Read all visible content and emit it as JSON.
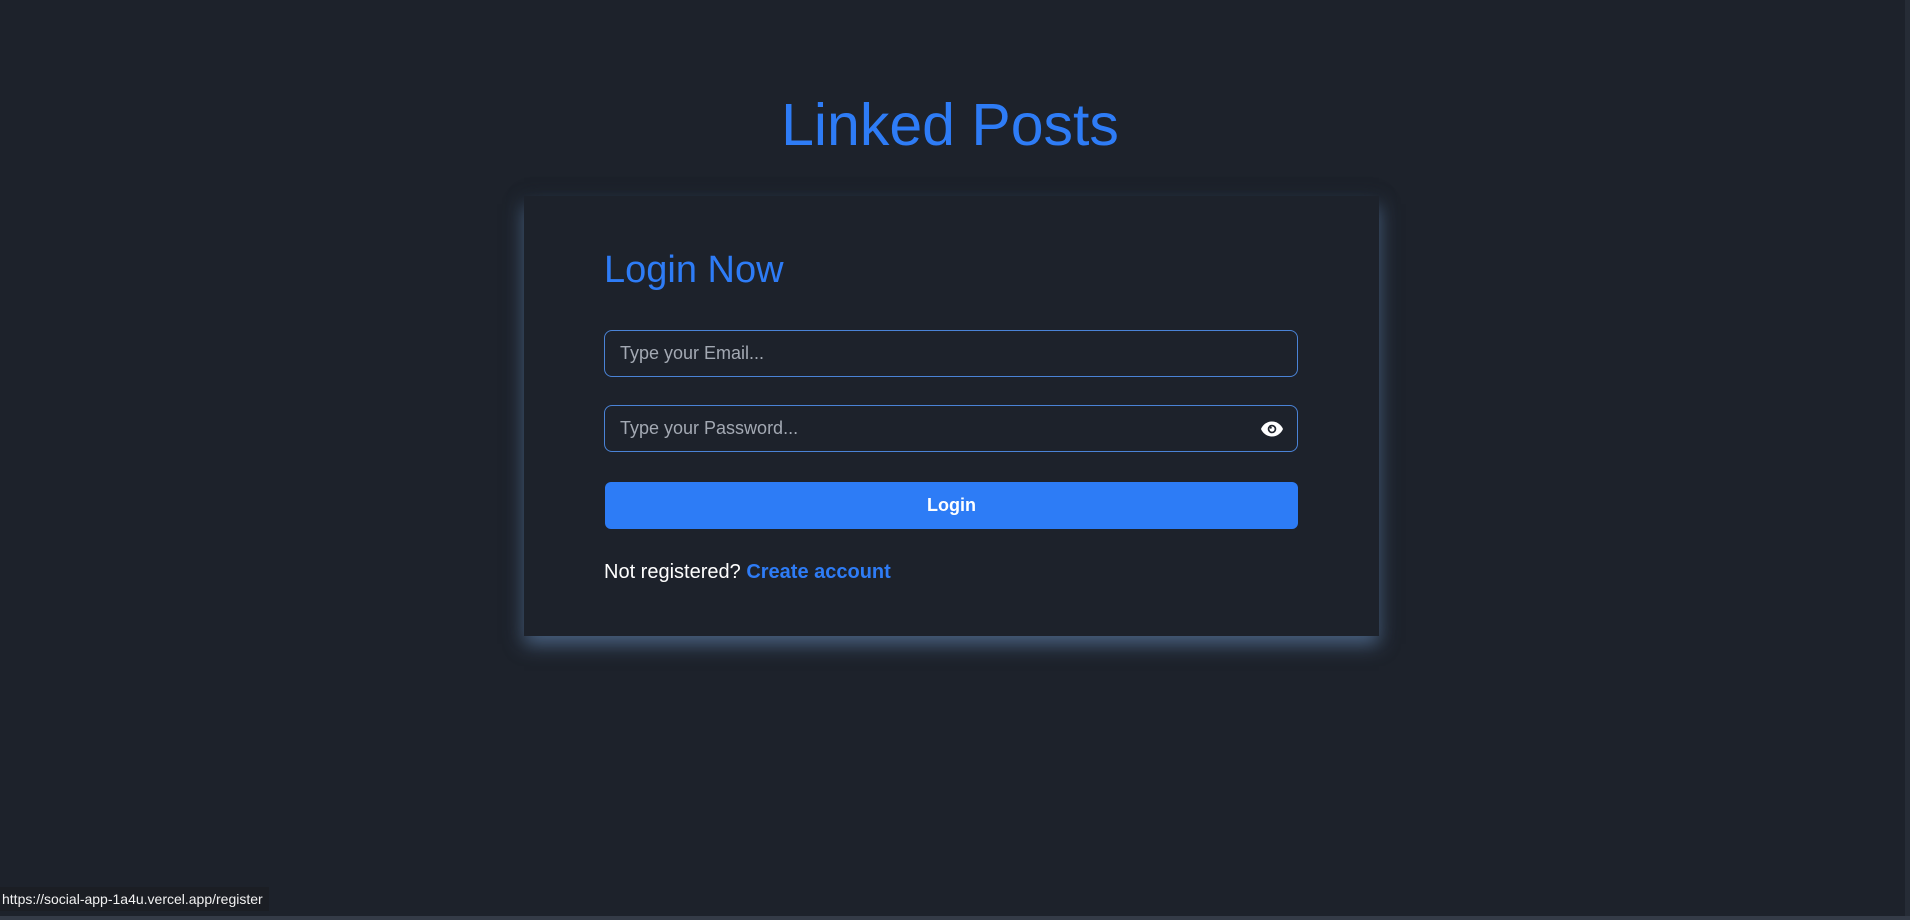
{
  "app": {
    "title": "Linked Posts"
  },
  "login": {
    "heading": "Login Now",
    "email": {
      "value": "",
      "placeholder": "Type your Email..."
    },
    "password": {
      "value": "",
      "placeholder": "Type your Password...",
      "toggle_icon": "eye-icon"
    },
    "submit_label": "Login",
    "register_prompt": "Not registered?",
    "register_link": "Create account"
  },
  "status_bar": {
    "url": "https://social-app-1a4u.vercel.app/register"
  },
  "colors": {
    "background": "#1d222b",
    "accent": "#2e7cf6",
    "input_border": "#4a83d6",
    "text": "#ffffff",
    "placeholder": "#a3a9b3"
  }
}
